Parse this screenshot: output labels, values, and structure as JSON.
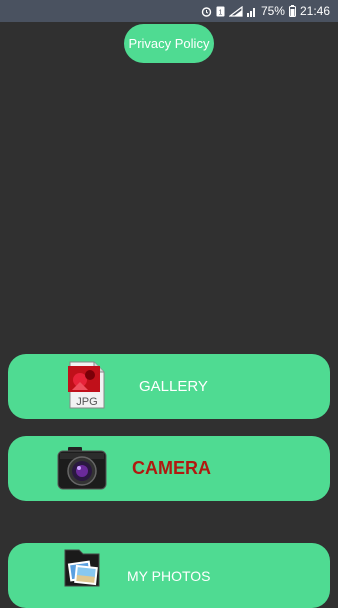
{
  "status_bar": {
    "battery": "75%",
    "time": "21:46",
    "icons": [
      "alarm-icon",
      "sim-icon",
      "signal-icon",
      "battery-icon"
    ]
  },
  "privacy": {
    "label": "Privacy Policy"
  },
  "buttons": {
    "gallery": {
      "label": "GALLERY",
      "icon": "jpg-image-icon"
    },
    "camera": {
      "label": "CAMERA",
      "icon": "camera-icon"
    },
    "my_photos": {
      "label": "MY PHOTOS",
      "icon": "photos-folder-icon"
    }
  },
  "colors": {
    "background": "#303030",
    "accent": "#4fdb92",
    "camera_text": "#b01a10",
    "statusbar": "#4a5260"
  }
}
